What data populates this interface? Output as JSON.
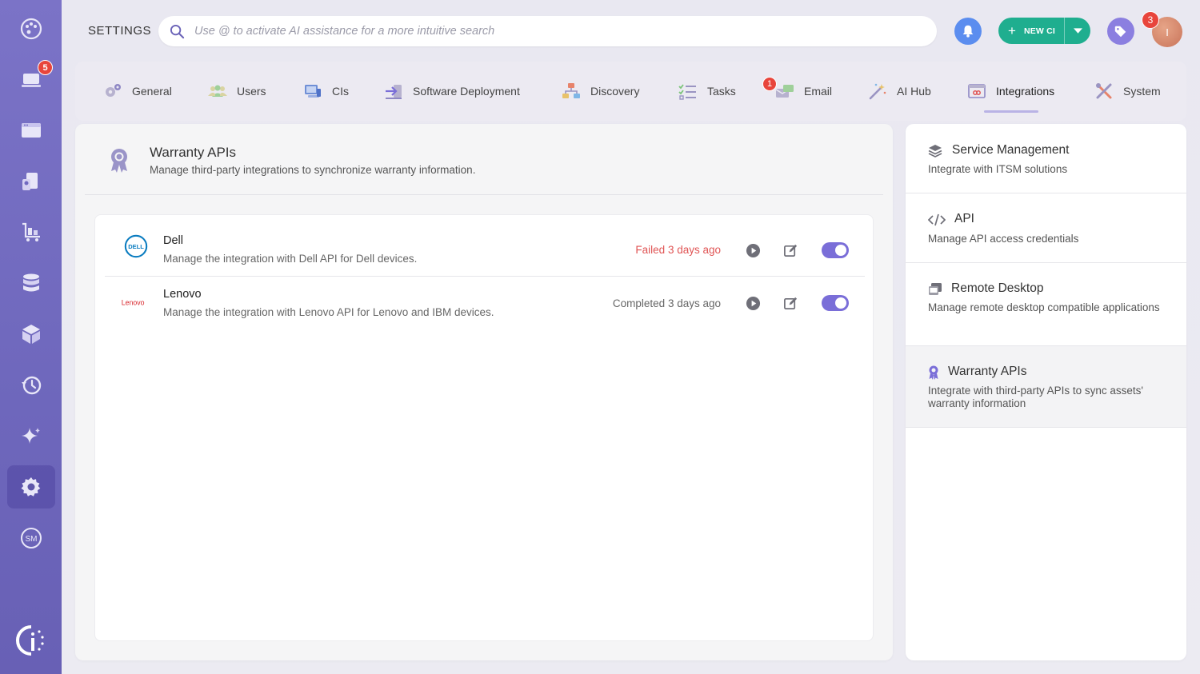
{
  "sidebar": {
    "badge_count": "5",
    "items": [
      {
        "icon": "palette-icon"
      },
      {
        "icon": "laptop-icon"
      },
      {
        "icon": "window-icon"
      },
      {
        "icon": "devices-icon"
      },
      {
        "icon": "cart-icon"
      },
      {
        "icon": "database-icon"
      },
      {
        "icon": "box-icon"
      },
      {
        "icon": "history-icon"
      },
      {
        "icon": "sparkle-icon"
      },
      {
        "icon": "gear-icon"
      },
      {
        "icon": "sm-icon",
        "label": "SM"
      }
    ],
    "logo": "brand-logo-icon"
  },
  "header": {
    "title": "SETTINGS",
    "search_placeholder": "Use @ to activate AI assistance for a more intuitive search",
    "new_ci_label": "NEW CI",
    "avatar_initial": "I",
    "avatar_badge": "3"
  },
  "tabs": [
    {
      "label": "General"
    },
    {
      "label": "Users"
    },
    {
      "label": "CIs"
    },
    {
      "label": "Software Deployment"
    },
    {
      "label": "Discovery"
    },
    {
      "label": "Tasks"
    },
    {
      "label": "Email",
      "badge": "1"
    },
    {
      "label": "AI Hub"
    },
    {
      "label": "Integrations",
      "active": true
    },
    {
      "label": "System"
    }
  ],
  "main": {
    "title": "Warranty APIs",
    "description": "Manage third-party integrations to synchronize warranty information.",
    "integrations": [
      {
        "name": "Dell",
        "logo_text": "DELL",
        "description": "Manage the integration with Dell API for Dell devices.",
        "status": "Failed 3 days ago",
        "status_type": "failed",
        "enabled": true
      },
      {
        "name": "Lenovo",
        "logo_text": "Lenovo",
        "description": "Manage the integration with Lenovo API for Lenovo and IBM devices.",
        "status": "Completed 3 days ago",
        "status_type": "completed",
        "enabled": true
      }
    ]
  },
  "right_panel": {
    "items": [
      {
        "title": "Service Management",
        "description": "Integrate with ITSM solutions",
        "icon": "layers-icon"
      },
      {
        "title": "API",
        "description": "Manage API access credentials",
        "icon": "code-icon"
      },
      {
        "title": "Remote Desktop",
        "description": "Manage remote desktop compatible applications",
        "icon": "remote-desktop-icon"
      },
      {
        "title": "Warranty APIs",
        "description": "Integrate with third-party APIs to sync assets' warranty information",
        "icon": "ribbon-icon",
        "active": true
      }
    ]
  },
  "colors": {
    "sidebar": "#7169c0",
    "accent": "#7a6ed8",
    "new_ci": "#1fae8f",
    "bell": "#5b8def",
    "failed": "#e05454",
    "badge": "#e8453c"
  }
}
